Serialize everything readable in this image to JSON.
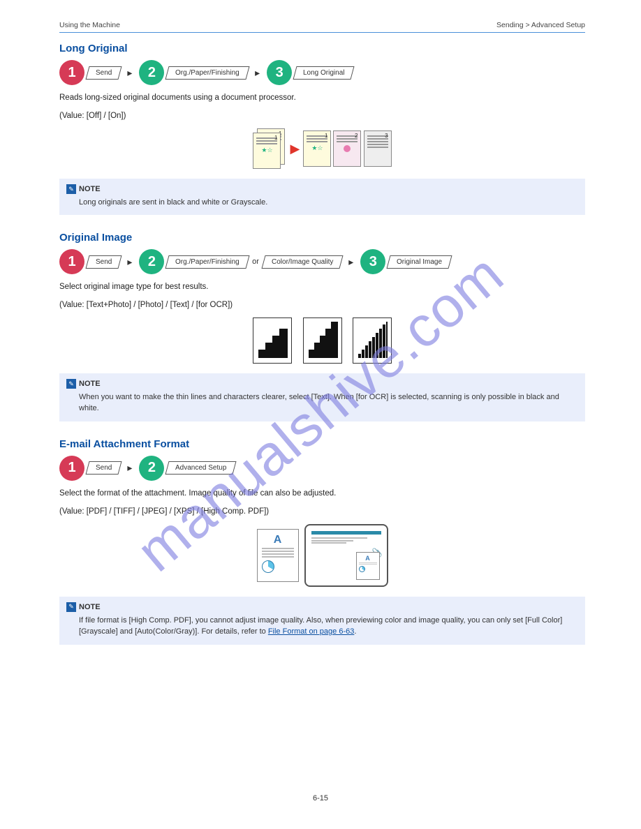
{
  "header": {
    "left": "Using the Machine",
    "right": "Sending > Advanced Setup"
  },
  "sections": [
    {
      "title": "Long Original",
      "flow": [
        {
          "color": "red",
          "num": "1",
          "tabs": [
            "Send"
          ]
        },
        {
          "color": "green",
          "num": "2",
          "tabs": [
            "Org./Paper/Finishing"
          ]
        },
        {
          "color": "green",
          "num": "3",
          "tabs": [
            "Long Original"
          ]
        }
      ],
      "description": "Reads long-sized original documents using a document processor.",
      "options": "(Value: [Off] / [On])",
      "note_label": "NOTE",
      "note_body": "Long originals are sent in black and white or Grayscale."
    },
    {
      "title": "Original Image",
      "flow": [
        {
          "color": "red",
          "num": "1",
          "tabs": [
            "Send"
          ]
        },
        {
          "color": "green",
          "num": "2",
          "tabs": [
            "Org./Paper/Finishing",
            "Color/Image Quality"
          ]
        },
        {
          "color": "green",
          "num": "3",
          "tabs": [
            "Original Image"
          ]
        }
      ],
      "description": "Select original image type for best results.",
      "options": "(Value: [Text+Photo] / [Photo] / [Text] / [for OCR])",
      "note_label": "NOTE",
      "note_body": "When you want to make the thin lines and characters clearer, select [Text]. When [for OCR] is selected, scanning is only possible in black and white."
    },
    {
      "title": "E-mail Attachment Format",
      "flow": [
        {
          "color": "red",
          "num": "1",
          "tabs": [
            "Send"
          ]
        },
        {
          "color": "green",
          "num": "2",
          "tabs": [
            "Advanced Setup"
          ]
        }
      ],
      "description": "Select the format of the attachment. Image quality of file can also be adjusted.",
      "options": "(Value: [PDF] / [TIFF] / [JPEG] / [XPS] / [High Comp. PDF])",
      "note_label": "NOTE",
      "note_body_pre": "If file format is [High Comp. PDF], you cannot adjust image quality. Also, when previewing color and image quality, you can only set [Full Color] [Grayscale] and [Auto(Color/Gray)]. For details, refer to ",
      "note_link": "File Format on page 6-63",
      "note_body_post": "."
    }
  ],
  "page_number": "6-15",
  "watermark": "manualshive.com"
}
